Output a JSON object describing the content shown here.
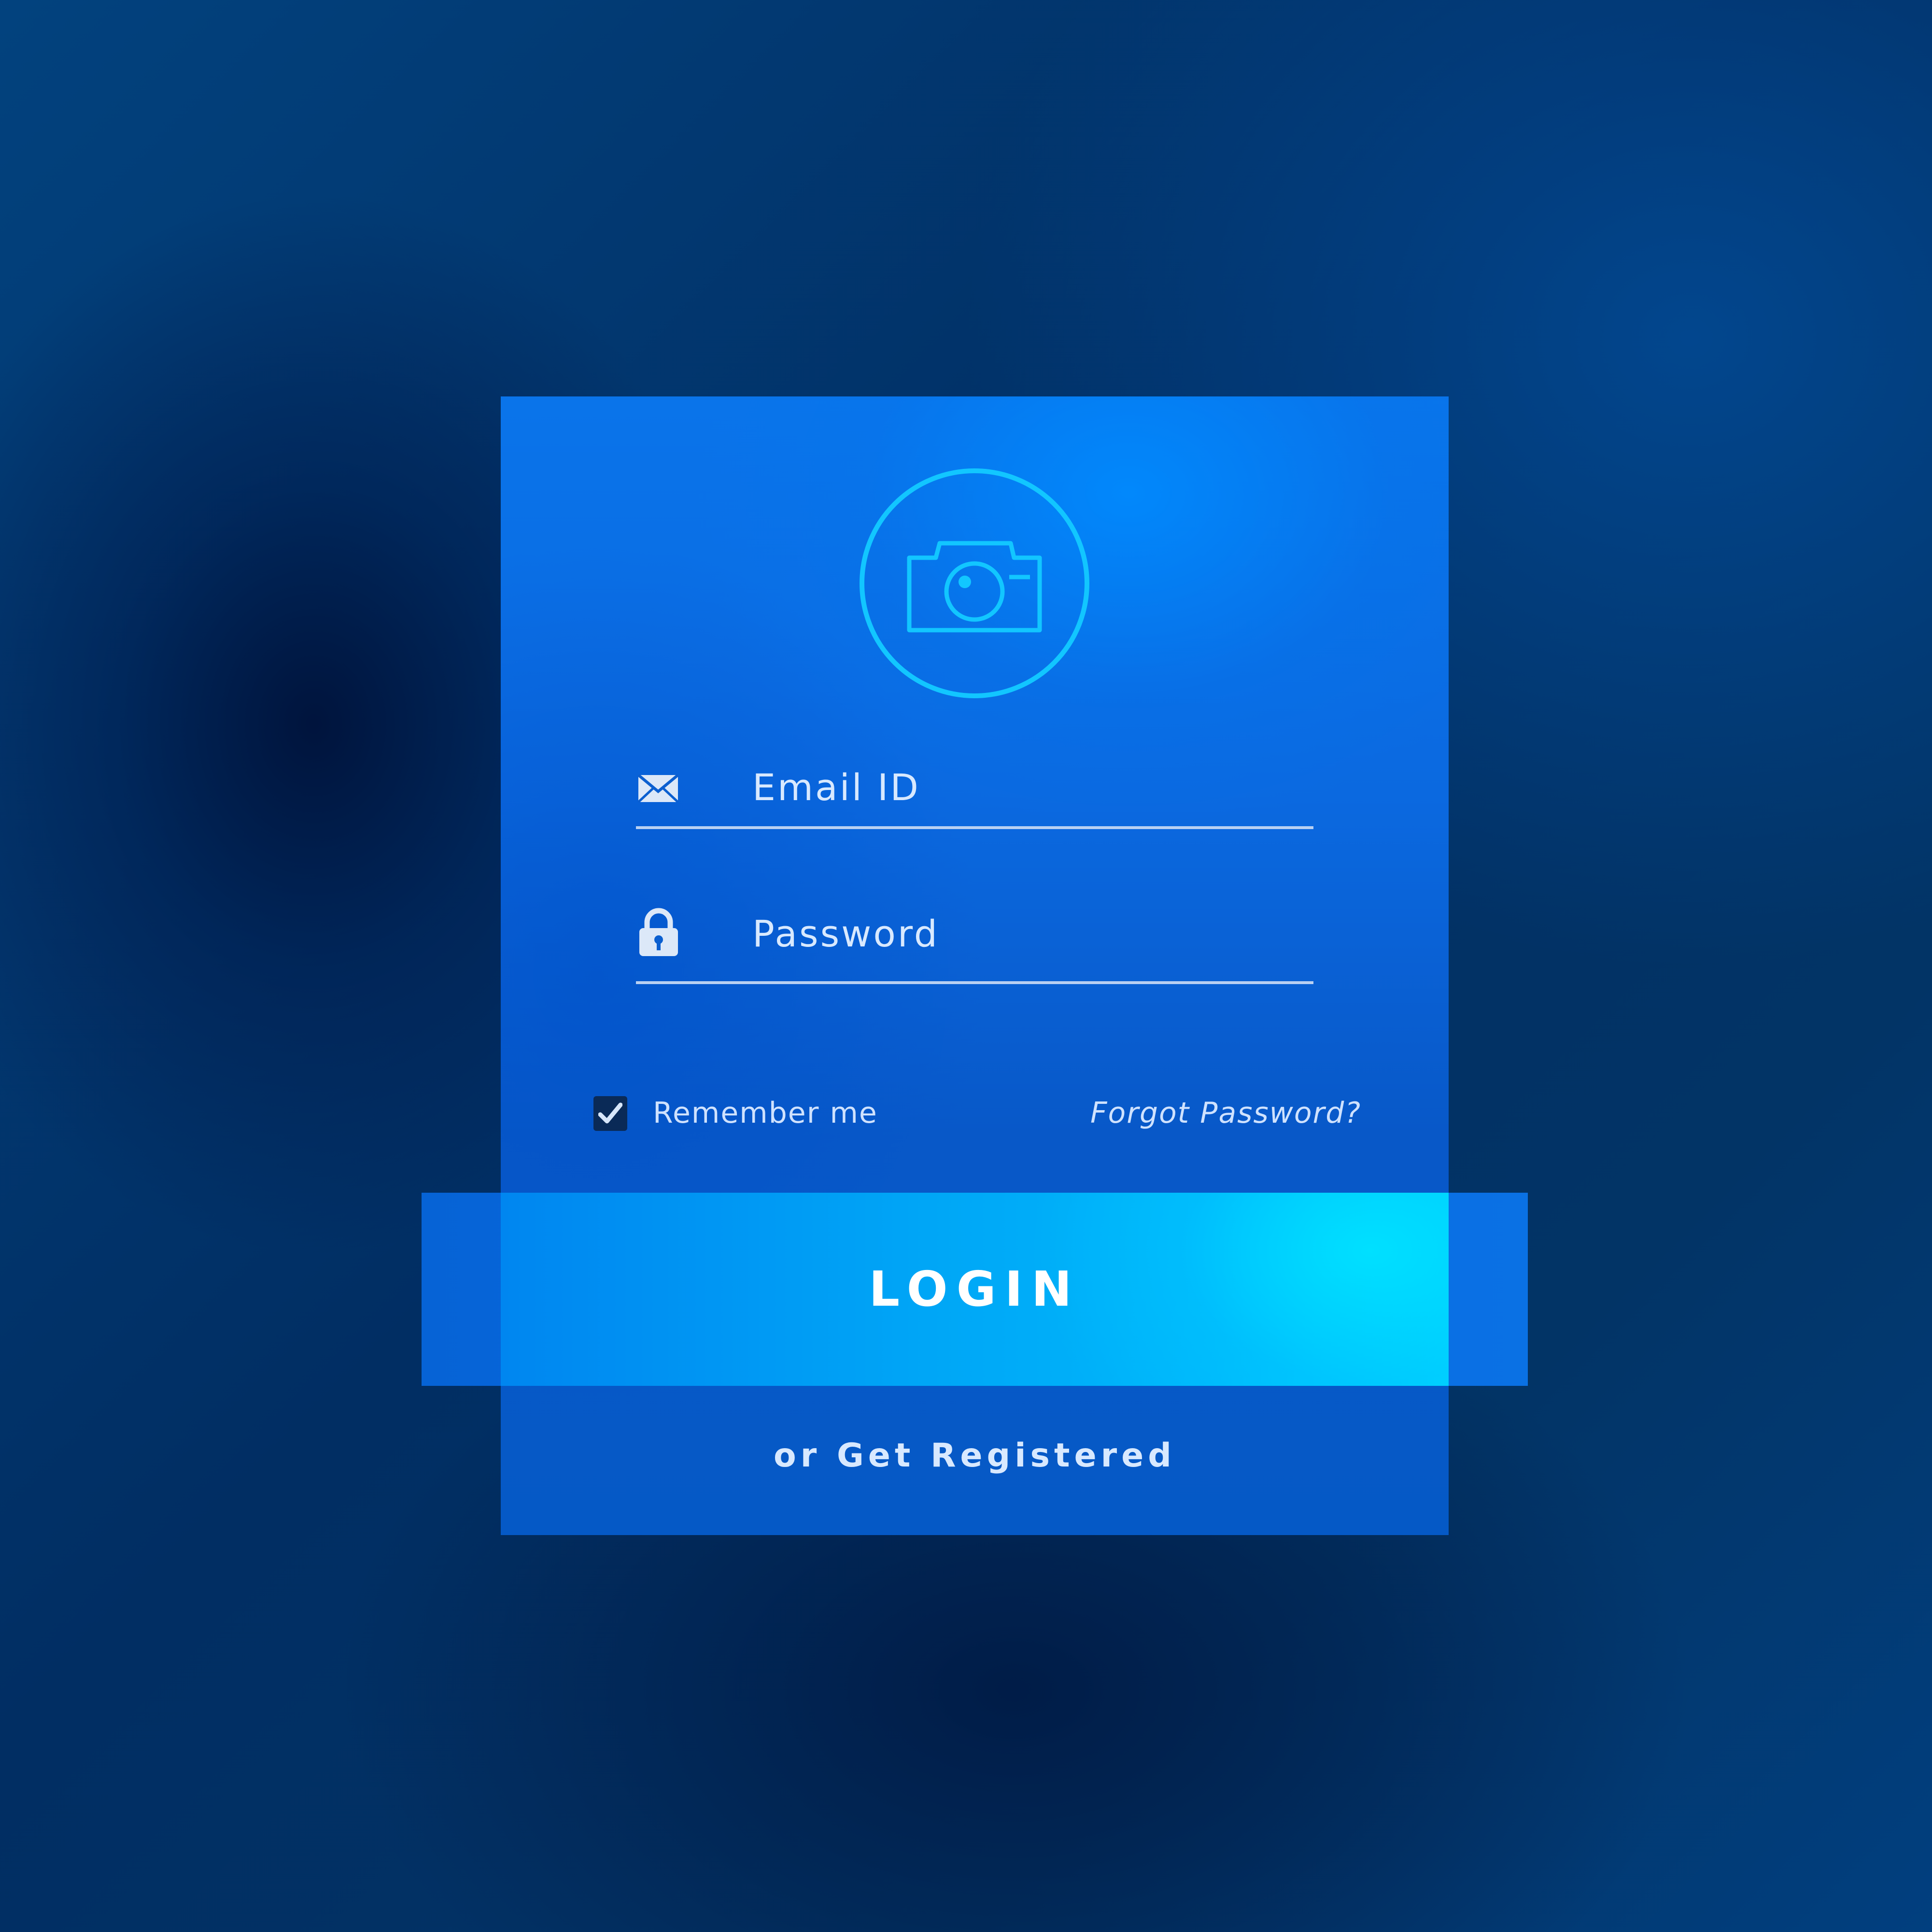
{
  "colors": {
    "accent": "#12c6ff",
    "card": "#0a6ae0",
    "background": "#012e63",
    "text": "#d8e9ff"
  },
  "avatar": {
    "icon": "camera-icon"
  },
  "form": {
    "email": {
      "icon": "envelope-icon",
      "placeholder": "Email ID",
      "value": ""
    },
    "password": {
      "icon": "lock-icon",
      "placeholder": "Password",
      "value": ""
    }
  },
  "remember": {
    "label": "Remember me",
    "checked": true
  },
  "forgot": {
    "label": "Forgot Password?"
  },
  "login": {
    "label": "LOGIN"
  },
  "register": {
    "label": "or Get Registered"
  }
}
